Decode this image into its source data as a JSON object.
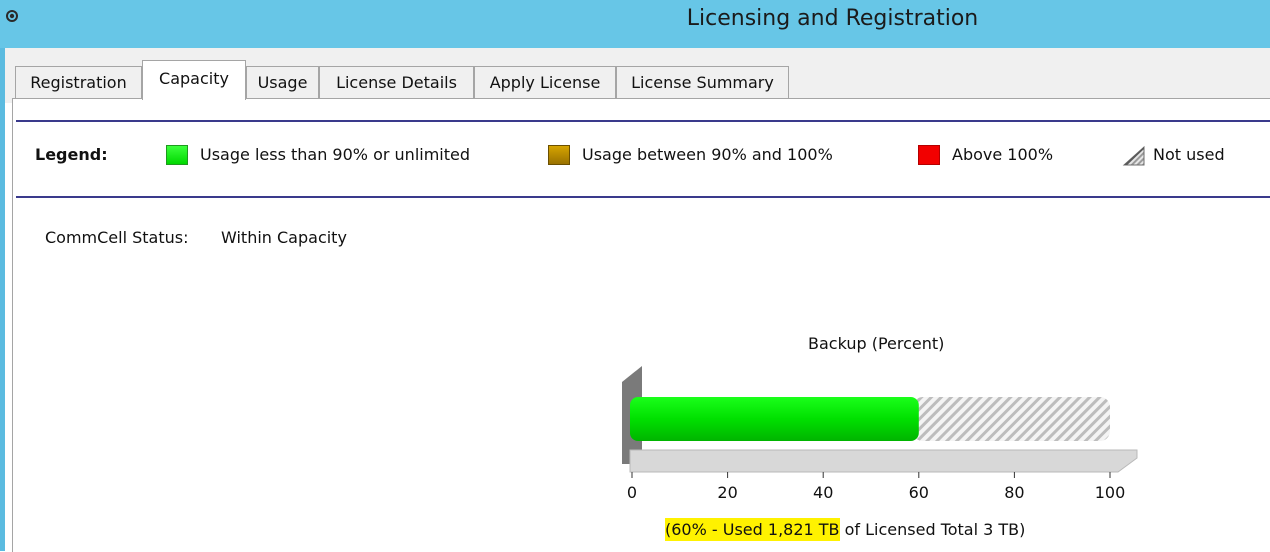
{
  "window": {
    "title": "Licensing and Registration",
    "icon": "gear-logo-icon"
  },
  "tabs": [
    {
      "label": "Registration",
      "active": false
    },
    {
      "label": "Capacity",
      "active": true
    },
    {
      "label": "Usage",
      "active": false
    },
    {
      "label": "License Details",
      "active": false
    },
    {
      "label": "Apply License",
      "active": false
    },
    {
      "label": "License Summary",
      "active": false
    }
  ],
  "legend": {
    "label": "Legend:",
    "items": [
      {
        "text": "Usage less than 90% or unlimited",
        "color": "#00e600",
        "icon": "green-square-icon"
      },
      {
        "text": "Usage between 90% and 100%",
        "color": "#b88a00",
        "icon": "gold-square-icon"
      },
      {
        "text": "Above 100%",
        "color": "#f20000",
        "icon": "red-square-icon"
      },
      {
        "text": "Not used",
        "color": "#c8c8c8",
        "icon": "hatched-square-icon"
      }
    ]
  },
  "commcell": {
    "status_label": "CommCell Status:",
    "status_value": "Within Capacity"
  },
  "usage_note": {
    "highlighted": "(60% - Used 1,821 TB",
    "rest": " of Licensed Total 3 TB)"
  },
  "chart_data": {
    "type": "bar",
    "orientation": "horizontal",
    "title": "Backup (Percent)",
    "xlim": [
      0,
      100
    ],
    "ticks": [
      0,
      20,
      40,
      60,
      80,
      100
    ],
    "series": [
      {
        "values": [
          60
        ]
      }
    ],
    "remainder_style": "hatched",
    "used_color": "#00e600"
  }
}
